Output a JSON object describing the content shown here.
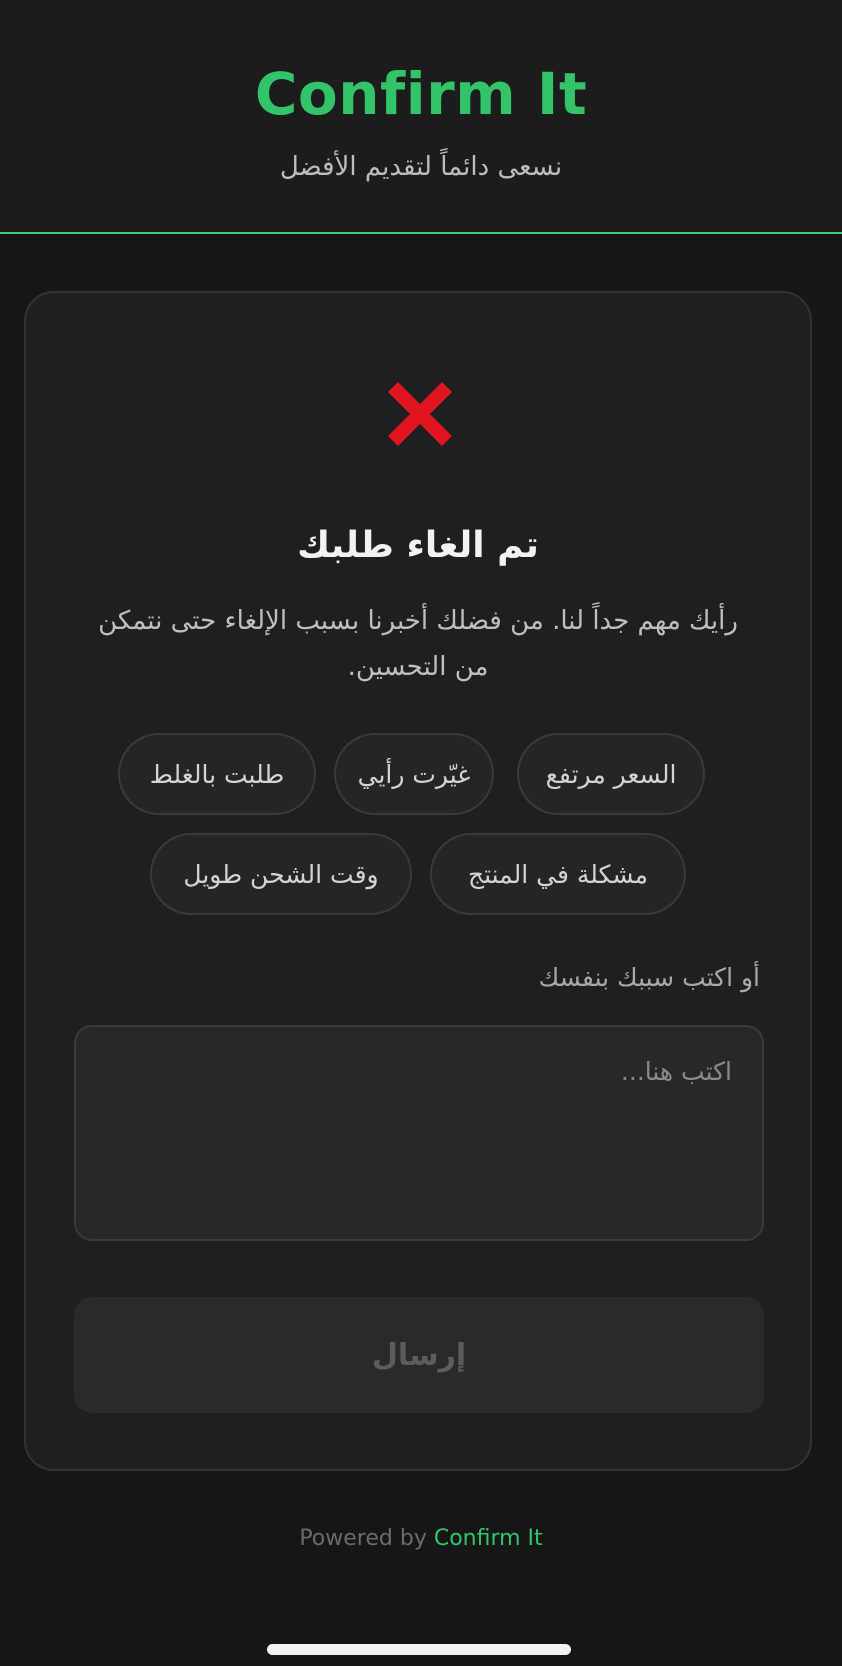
{
  "header": {
    "brand": "Confirm It",
    "tagline": "نسعى دائماً لتقديم الأفضل",
    "accent_color": "#33c46a"
  },
  "card": {
    "icon": "cancel-x-icon",
    "icon_color": "#e0141e",
    "title": "تم الغاء طلبك",
    "description": "رأيك مهم جداً لنا. من فضلك أخبرنا بسبب الإلغاء حتى نتمكن من التحسين.",
    "reasons": [
      "السعر مرتفع",
      "غيّرت رأيي",
      "طلبت بالغلط",
      "مشكلة في المنتج",
      "وقت الشحن طويل"
    ],
    "custom_reason_label": "أو اكتب سببك بنفسك",
    "custom_reason_placeholder": "اكتب هنا...",
    "custom_reason_value": "",
    "submit_label": "إرسال"
  },
  "footer": {
    "powered_by": "Powered by",
    "brand": "Confirm It"
  }
}
